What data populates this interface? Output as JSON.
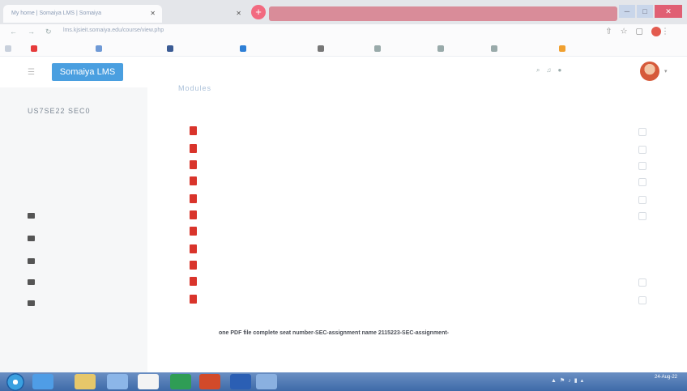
{
  "browser": {
    "active_tab_title": "My home | Somaiya LMS | Somaiya",
    "second_tab_title": "",
    "new_tab_label": "+",
    "red_banner_text": "",
    "url": "lms.kjsieit.somaiya.edu/course/view.php"
  },
  "bookmarks": [],
  "lms": {
    "brand": "Somaiya LMS",
    "username": ""
  },
  "sidebar": {
    "course_code": "US7SE22 SEC0",
    "items": [
      "",
      "",
      "",
      "",
      "",
      "",
      "",
      ""
    ]
  },
  "main": {
    "title": "Modules",
    "description": "",
    "activities": [
      "",
      "",
      "",
      "",
      "",
      "",
      "",
      "",
      "",
      "",
      ""
    ],
    "subheading": "",
    "paragraph": {
      "prefix": "",
      "bold1": "one PDF file",
      "mid1": "",
      "bold2": "complete seat number-SEC-assignment name",
      "mid2": "",
      "bold3": "2115223-SEC-assignment-",
      "suffix": ""
    }
  },
  "taskbar": {
    "clock_time": "",
    "clock_date": "24-Aug-22"
  },
  "colors": {
    "brand": "#4a9fe0",
    "pdf_icon": "#d9342b",
    "newtab": "#f26a80",
    "taskbar": "#3e6aa8"
  }
}
